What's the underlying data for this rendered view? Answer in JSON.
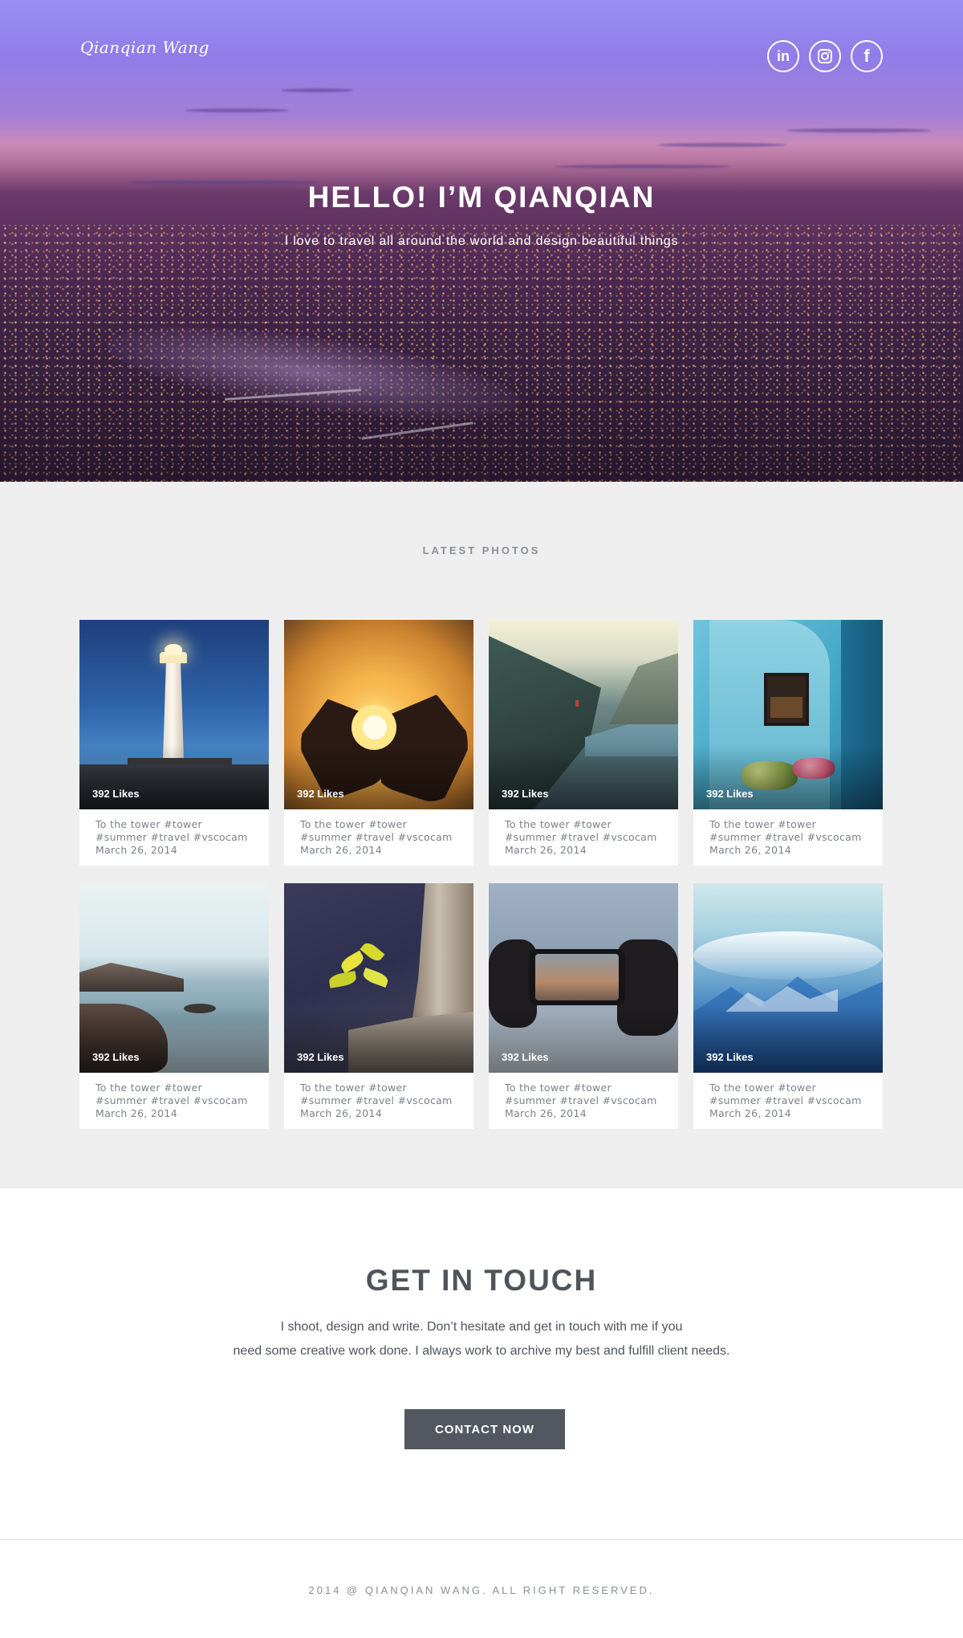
{
  "header": {
    "logo": "Qianqian Wang",
    "social": [
      {
        "icon": "linkedin-icon",
        "glyph": "in"
      },
      {
        "icon": "instagram-icon",
        "glyph": ""
      },
      {
        "icon": "facebook-icon",
        "glyph": "f"
      }
    ],
    "title": "HELLO! I’M QIANQIAN",
    "subtitle": "I love to travel all around the world and design beautiful things"
  },
  "photos": {
    "section_title": "LATEST PHOTOS",
    "items": [
      {
        "likes": "392 Likes",
        "caption": "To the tower #tower #summer #travel #vscocam",
        "date": "March 26, 2014",
        "subject": "lighthouse"
      },
      {
        "likes": "392 Likes",
        "caption": "To the tower #tower #summer #travel #vscocam",
        "date": "March 26, 2014",
        "subject": "heart-hands-sunset"
      },
      {
        "likes": "392 Likes",
        "caption": "To the tower #tower #summer #travel #vscocam",
        "date": "March 26, 2014",
        "subject": "fjord-cliff"
      },
      {
        "likes": "392 Likes",
        "caption": "To the tower #tower #summer #travel #vscocam",
        "date": "March 26, 2014",
        "subject": "blue-wall-window"
      },
      {
        "likes": "392 Likes",
        "caption": "To the tower #tower #summer #travel #vscocam",
        "date": "March 26, 2014",
        "subject": "rocky-seashore"
      },
      {
        "likes": "392 Likes",
        "caption": "To the tower #tower #summer #travel #vscocam",
        "date": "March 26, 2014",
        "subject": "plant-on-rock"
      },
      {
        "likes": "392 Likes",
        "caption": "To the tower #tower #summer #travel #vscocam",
        "date": "March 26, 2014",
        "subject": "phone-camera"
      },
      {
        "likes": "392 Likes",
        "caption": "To the tower #tower #summer #travel #vscocam",
        "date": "March 26, 2014",
        "subject": "mountains-clouds"
      }
    ]
  },
  "contact": {
    "title": "GET IN TOUCH",
    "line1": "I shoot, design and write. Don’t hesitate and get in touch with me if you",
    "line2": "need some creative work done. I always work to archive my best and fulfill client needs.",
    "button": "CONTACT NOW"
  },
  "footer": {
    "copyright": "2014 @ QIANQIAN WANG. ALL RIGHT RESERVED."
  },
  "colors": {
    "accent_dark": "#535860",
    "section_bg": "#eeeeee",
    "text": "#4f545c",
    "muted": "#8a8f96"
  }
}
